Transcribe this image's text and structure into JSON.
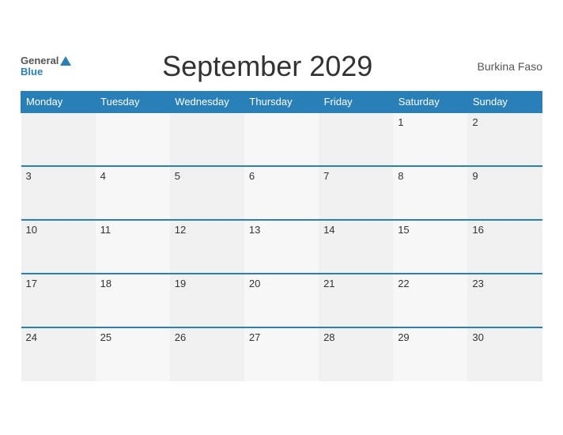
{
  "header": {
    "title": "September 2029",
    "country": "Burkina Faso",
    "logo_general": "General",
    "logo_blue": "Blue"
  },
  "days_of_week": [
    "Monday",
    "Tuesday",
    "Wednesday",
    "Thursday",
    "Friday",
    "Saturday",
    "Sunday"
  ],
  "weeks": [
    [
      "",
      "",
      "",
      "",
      "",
      "1",
      "2"
    ],
    [
      "3",
      "4",
      "5",
      "6",
      "7",
      "8",
      "9"
    ],
    [
      "10",
      "11",
      "12",
      "13",
      "14",
      "15",
      "16"
    ],
    [
      "17",
      "18",
      "19",
      "20",
      "21",
      "22",
      "23"
    ],
    [
      "24",
      "25",
      "26",
      "27",
      "28",
      "29",
      "30"
    ]
  ]
}
